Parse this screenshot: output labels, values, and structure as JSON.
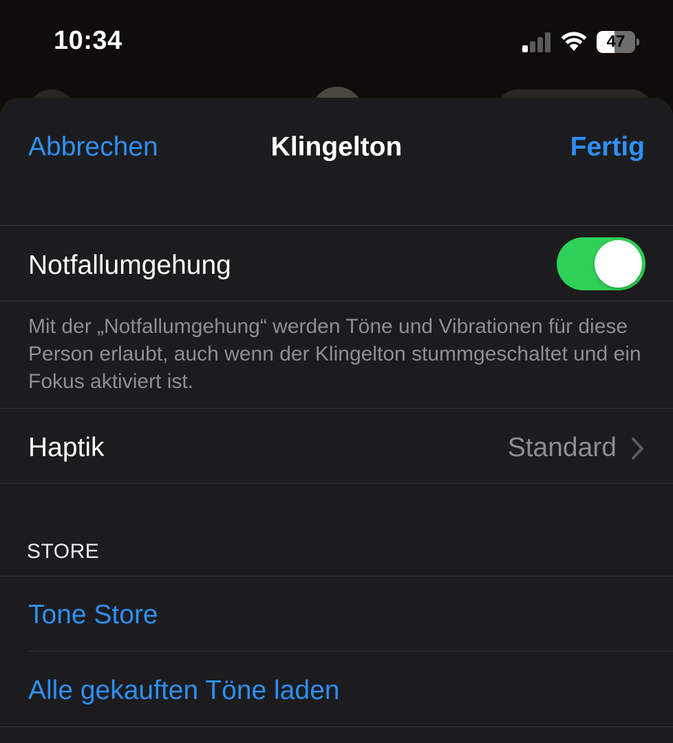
{
  "status_bar": {
    "time": "10:34",
    "battery_level": "47",
    "battery_percent": 47,
    "icons": [
      "cellular-signal-icon",
      "wifi-icon",
      "battery-icon"
    ]
  },
  "colors": {
    "accent": "#2f8ff5",
    "toggle_on": "#30d158",
    "sheet_background": "#1c1c1e",
    "secondary_text": "#8e8e93"
  },
  "nav": {
    "cancel_label": "Abbrechen",
    "title": "Klingelton",
    "done_label": "Fertig"
  },
  "emergency_bypass": {
    "label": "Notfallumgehung",
    "enabled": true,
    "footnote": "Mit der „Notfallumgehung“ werden Töne und Vibrationen für diese Person erlaubt, auch wenn der Klingelton stummgeschaltet und ein Fokus aktiviert ist."
  },
  "haptics": {
    "label": "Haptik",
    "value": "Standard",
    "icon": "chevron-right-icon"
  },
  "store": {
    "header": "STORE",
    "items": [
      {
        "label": "Tone Store"
      },
      {
        "label": "Alle gekauften Töne laden"
      }
    ]
  }
}
